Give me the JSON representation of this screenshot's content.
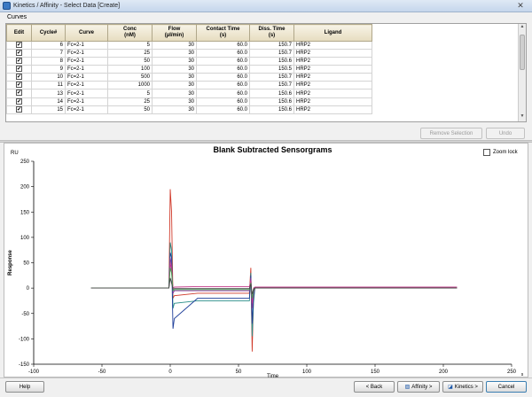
{
  "window": {
    "title": "Kinetics / Affinity - Select Data [Create]",
    "close_glyph": "✕"
  },
  "curves_label": "Curves",
  "table": {
    "columns": [
      "Edit",
      "Cycle#",
      "Curve",
      "Conc\n(nM)",
      "Flow\n(µl/min)",
      "Contact Time\n(s)",
      "Diss. Time\n(s)",
      "Ligand"
    ],
    "rows": [
      {
        "edit": true,
        "cycle": "6",
        "curve": "Fc=2-1",
        "conc": "5",
        "flow": "30",
        "contact": "60.0",
        "diss": "150.7",
        "ligand": "HRP2"
      },
      {
        "edit": true,
        "cycle": "7",
        "curve": "Fc=2-1",
        "conc": "25",
        "flow": "30",
        "contact": "60.0",
        "diss": "150.7",
        "ligand": "HRP2"
      },
      {
        "edit": true,
        "cycle": "8",
        "curve": "Fc=2-1",
        "conc": "50",
        "flow": "30",
        "contact": "60.0",
        "diss": "150.6",
        "ligand": "HRP2"
      },
      {
        "edit": true,
        "cycle": "9",
        "curve": "Fc=2-1",
        "conc": "100",
        "flow": "30",
        "contact": "60.0",
        "diss": "150.5",
        "ligand": "HRP2"
      },
      {
        "edit": true,
        "cycle": "10",
        "curve": "Fc=2-1",
        "conc": "500",
        "flow": "30",
        "contact": "60.0",
        "diss": "150.7",
        "ligand": "HRP2"
      },
      {
        "edit": true,
        "cycle": "11",
        "curve": "Fc=2-1",
        "conc": "1000",
        "flow": "30",
        "contact": "60.0",
        "diss": "150.7",
        "ligand": "HRP2"
      },
      {
        "edit": true,
        "cycle": "13",
        "curve": "Fc=2-1",
        "conc": "5",
        "flow": "30",
        "contact": "60.0",
        "diss": "150.6",
        "ligand": "HRP2"
      },
      {
        "edit": true,
        "cycle": "14",
        "curve": "Fc=2-1",
        "conc": "25",
        "flow": "30",
        "contact": "60.0",
        "diss": "150.6",
        "ligand": "HRP2"
      },
      {
        "edit": true,
        "cycle": "15",
        "curve": "Fc=2-1",
        "conc": "50",
        "flow": "30",
        "contact": "60.0",
        "diss": "150.6",
        "ligand": "HRP2"
      }
    ]
  },
  "buttons": {
    "remove_selection": "Remove Selection",
    "undo": "Undo",
    "help": "Help",
    "back": "< Back",
    "affinity": "Affinity >",
    "kinetics": "Kinetics >",
    "cancel": "Cancel"
  },
  "zoom_lock": {
    "label": "Zoom lock",
    "checked": false
  },
  "chart_data": {
    "type": "line",
    "title": "Blank Subtracted Sensorgrams",
    "unit_label": "RU",
    "xlabel": "Time",
    "ylabel": "Response",
    "corner_mark": "s",
    "xlim": [
      -100,
      250
    ],
    "ylim": [
      -150,
      250
    ],
    "xticks": [
      -100,
      -50,
      0,
      50,
      100,
      150,
      200,
      250
    ],
    "yticks": [
      -150,
      -100,
      -50,
      0,
      50,
      100,
      150,
      200,
      250
    ],
    "series": [
      {
        "color": "#d03a2a",
        "values": [
          [
            -58,
            0
          ],
          [
            -1,
            0
          ],
          [
            0,
            195
          ],
          [
            1,
            150
          ],
          [
            2,
            -20
          ],
          [
            3,
            -15
          ],
          [
            20,
            -10
          ],
          [
            58,
            -10
          ],
          [
            59,
            40
          ],
          [
            60,
            -125
          ],
          [
            61,
            -20
          ],
          [
            62,
            0
          ],
          [
            210,
            0
          ]
        ]
      },
      {
        "color": "#2b8f8a",
        "values": [
          [
            -58,
            0
          ],
          [
            -1,
            0
          ],
          [
            0,
            90
          ],
          [
            1,
            75
          ],
          [
            2,
            -40
          ],
          [
            3,
            -30
          ],
          [
            20,
            -25
          ],
          [
            58,
            -25
          ],
          [
            59,
            30
          ],
          [
            60,
            -95
          ],
          [
            61,
            -30
          ],
          [
            62,
            0
          ],
          [
            210,
            0
          ]
        ]
      },
      {
        "color": "#1f3f9a",
        "values": [
          [
            -58,
            0
          ],
          [
            -1,
            0
          ],
          [
            0,
            70
          ],
          [
            1,
            60
          ],
          [
            2,
            -80
          ],
          [
            3,
            -60
          ],
          [
            20,
            -20
          ],
          [
            58,
            -20
          ],
          [
            59,
            25
          ],
          [
            60,
            -70
          ],
          [
            61,
            -15
          ],
          [
            62,
            0
          ],
          [
            210,
            0
          ]
        ]
      },
      {
        "color": "#8a3a9a",
        "values": [
          [
            -58,
            0
          ],
          [
            -1,
            0
          ],
          [
            0,
            60
          ],
          [
            1,
            45
          ],
          [
            2,
            -10
          ],
          [
            3,
            -5
          ],
          [
            20,
            -5
          ],
          [
            58,
            -5
          ],
          [
            59,
            20
          ],
          [
            60,
            -40
          ],
          [
            61,
            -10
          ],
          [
            62,
            0
          ],
          [
            210,
            0
          ]
        ]
      },
      {
        "color": "#c23a8a",
        "values": [
          [
            -58,
            0
          ],
          [
            -1,
            0
          ],
          [
            0,
            50
          ],
          [
            1,
            35
          ],
          [
            2,
            0
          ],
          [
            3,
            2
          ],
          [
            20,
            3
          ],
          [
            58,
            3
          ],
          [
            59,
            15
          ],
          [
            60,
            -30
          ],
          [
            61,
            0
          ],
          [
            62,
            2
          ],
          [
            210,
            2
          ]
        ]
      },
      {
        "color": "#3fa34d",
        "values": [
          [
            -58,
            0
          ],
          [
            -1,
            0
          ],
          [
            0,
            40
          ],
          [
            1,
            30
          ],
          [
            2,
            -5
          ],
          [
            3,
            -3
          ],
          [
            20,
            -3
          ],
          [
            58,
            -3
          ],
          [
            59,
            10
          ],
          [
            60,
            -20
          ],
          [
            61,
            -5
          ],
          [
            62,
            0
          ],
          [
            210,
            0
          ]
        ]
      },
      {
        "color": "#444444",
        "values": [
          [
            -58,
            0
          ],
          [
            -1,
            0
          ],
          [
            0,
            20
          ],
          [
            1,
            10
          ],
          [
            2,
            -2
          ],
          [
            3,
            -1
          ],
          [
            20,
            -1
          ],
          [
            58,
            -1
          ],
          [
            59,
            8
          ],
          [
            60,
            -12
          ],
          [
            61,
            -2
          ],
          [
            62,
            0
          ],
          [
            210,
            0
          ]
        ]
      }
    ]
  }
}
